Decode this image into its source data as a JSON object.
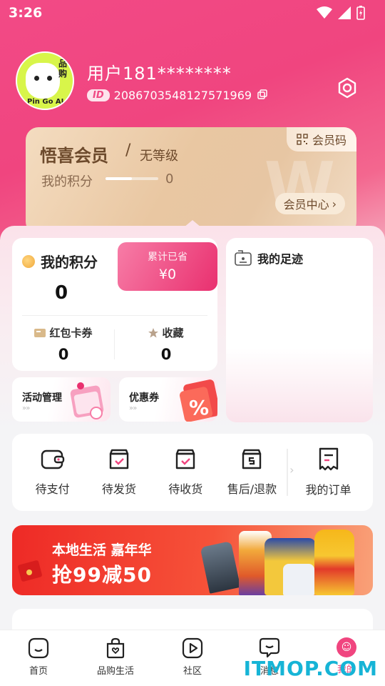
{
  "status_bar": {
    "time": "3:26"
  },
  "profile": {
    "name": "用户181********",
    "id_badge": "ID",
    "user_id": "2086703548127571969",
    "avatar_text": "Pin Go AI",
    "avatar_side_text": "品购"
  },
  "member_card": {
    "title": "悟喜会员",
    "slash": "/",
    "level": "无等级",
    "points_label": "我的积分",
    "points_value": "0",
    "points_progress": 0.5,
    "member_code_label": "会员码",
    "member_center_label": "会员中心"
  },
  "points_card": {
    "title": "我的积分",
    "value": "0",
    "saved_label": "累计已省",
    "saved_value": "¥0",
    "coupons_label": "红包卡券",
    "coupons_value": "0",
    "favorites_label": "收藏",
    "favorites_value": "0"
  },
  "mini_cards": {
    "activity": "活动管理",
    "coupon": "优惠券"
  },
  "footprint": {
    "title": "我的足迹"
  },
  "orders": {
    "items": [
      {
        "label": "待支付",
        "icon": "wallet-icon"
      },
      {
        "label": "待发货",
        "icon": "box-check-icon"
      },
      {
        "label": "待收货",
        "icon": "box-check-icon"
      },
      {
        "label": "售后/退款",
        "icon": "box-refund-icon"
      }
    ],
    "my_orders_label": "我的订单"
  },
  "banner": {
    "line1": "本地生活 嘉年华",
    "line2": "抢99减50"
  },
  "tab_bar": {
    "tabs": [
      {
        "label": "首页",
        "icon": "home-icon"
      },
      {
        "label": "品购生活",
        "icon": "shopping-bag-icon"
      },
      {
        "label": "社区",
        "icon": "play-icon"
      },
      {
        "label": "消息",
        "icon": "message-icon"
      },
      {
        "label": "我的",
        "icon": "profile-icon"
      }
    ]
  },
  "watermark": "ITMOP.COM",
  "colors": {
    "accent": "#f0457f",
    "gold_text": "#6d4a2c",
    "banner_red": "#ee2a26"
  }
}
